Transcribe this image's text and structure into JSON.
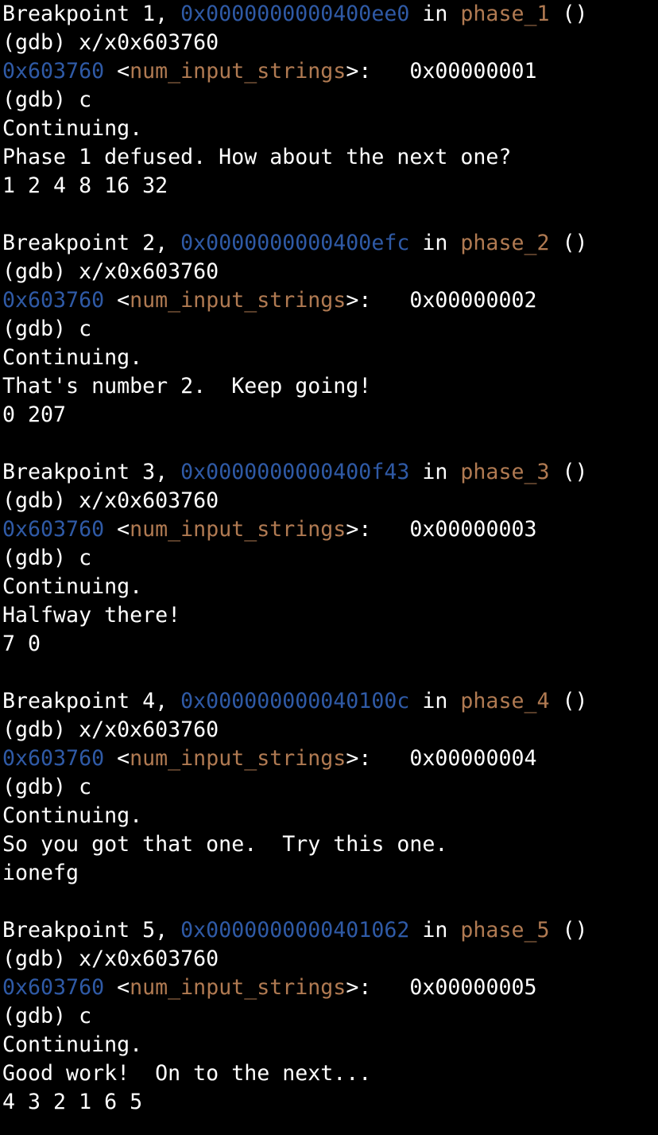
{
  "colors": {
    "background": "#000000",
    "text": "#ffffff",
    "address": "#2f5aa6",
    "symbol": "#b07a52"
  },
  "blocks": [
    {
      "bp_prefix": "Breakpoint 1, ",
      "bp_addr": "0x0000000000400ee0",
      "bp_in": " in ",
      "bp_func": "phase_1",
      "bp_suffix": " ()",
      "cmd_examine": "(gdb) x/x0x603760",
      "mem_addr": "0x603760",
      "mem_lt": " <",
      "mem_sym": "num_input_strings",
      "mem_gt": ">:",
      "mem_value": "   0x00000001",
      "cmd_continue": "(gdb) c",
      "continuing": "Continuing.",
      "message": "Phase 1 defused. How about the next one?",
      "answer": "1 2 4 8 16 32"
    },
    {
      "bp_prefix": "Breakpoint 2, ",
      "bp_addr": "0x0000000000400efc",
      "bp_in": " in ",
      "bp_func": "phase_2",
      "bp_suffix": " ()",
      "cmd_examine": "(gdb) x/x0x603760",
      "mem_addr": "0x603760",
      "mem_lt": " <",
      "mem_sym": "num_input_strings",
      "mem_gt": ">:",
      "mem_value": "   0x00000002",
      "cmd_continue": "(gdb) c",
      "continuing": "Continuing.",
      "message": "That's number 2.  Keep going!",
      "answer": "0 207"
    },
    {
      "bp_prefix": "Breakpoint 3, ",
      "bp_addr": "0x0000000000400f43",
      "bp_in": " in ",
      "bp_func": "phase_3",
      "bp_suffix": " ()",
      "cmd_examine": "(gdb) x/x0x603760",
      "mem_addr": "0x603760",
      "mem_lt": " <",
      "mem_sym": "num_input_strings",
      "mem_gt": ">:",
      "mem_value": "   0x00000003",
      "cmd_continue": "(gdb) c",
      "continuing": "Continuing.",
      "message": "Halfway there!",
      "answer": "7 0"
    },
    {
      "bp_prefix": "Breakpoint 4, ",
      "bp_addr": "0x000000000040100c",
      "bp_in": " in ",
      "bp_func": "phase_4",
      "bp_suffix": " ()",
      "cmd_examine": "(gdb) x/x0x603760",
      "mem_addr": "0x603760",
      "mem_lt": " <",
      "mem_sym": "num_input_strings",
      "mem_gt": ">:",
      "mem_value": "   0x00000004",
      "cmd_continue": "(gdb) c",
      "continuing": "Continuing.",
      "message": "So you got that one.  Try this one.",
      "answer": "ionefg"
    },
    {
      "bp_prefix": "Breakpoint 5, ",
      "bp_addr": "0x0000000000401062",
      "bp_in": " in ",
      "bp_func": "phase_5",
      "bp_suffix": " ()",
      "cmd_examine": "(gdb) x/x0x603760",
      "mem_addr": "0x603760",
      "mem_lt": " <",
      "mem_sym": "num_input_strings",
      "mem_gt": ">:",
      "mem_value": "   0x00000005",
      "cmd_continue": "(gdb) c",
      "continuing": "Continuing.",
      "message": "Good work!  On to the next...",
      "answer": "4 3 2 1 6 5"
    }
  ]
}
